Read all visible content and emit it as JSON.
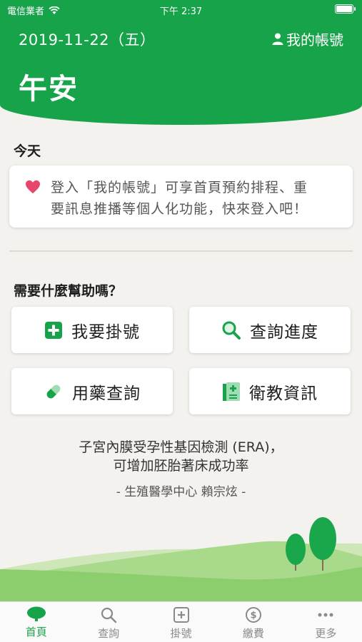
{
  "status_bar": {
    "carrier": "電信業者",
    "time": "下午 2:37",
    "battery_level": 1.0
  },
  "header": {
    "date": "2019-11-22（五）",
    "account_label": "我的帳號",
    "greeting": "午安"
  },
  "today": {
    "title": "今天",
    "card_line1": "登入「我的帳號」可享首頁預約排程、重",
    "card_line2": "要訊息推播等個人化功能，快來登入吧！"
  },
  "help": {
    "title": "需要什麼幫助嗎？",
    "buttons": [
      {
        "label": "我要掛號",
        "icon": "plus-square-icon"
      },
      {
        "label": "查詢進度",
        "icon": "search-icon"
      },
      {
        "label": "用藥查詢",
        "icon": "pill-icon"
      },
      {
        "label": "衛教資訊",
        "icon": "medical-document-icon"
      }
    ]
  },
  "promo": {
    "line1": "子宮內膜受孕性基因檢測 (ERA)，",
    "line2": "可增加胚胎著床成功率",
    "author": "- 生殖醫學中心 賴宗炫 -"
  },
  "tabs": [
    {
      "label": "首頁",
      "icon": "tree-icon",
      "active": true
    },
    {
      "label": "查詢",
      "icon": "search-icon",
      "active": false
    },
    {
      "label": "掛號",
      "icon": "plus-square-icon",
      "active": false
    },
    {
      "label": "繳費",
      "icon": "dollar-circle-icon",
      "active": false
    },
    {
      "label": "更多",
      "icon": "more-icon",
      "active": false
    }
  ],
  "colors": {
    "brand_green": "#16a34a",
    "heart": "#e8456b",
    "background": "#f4f2ee"
  }
}
